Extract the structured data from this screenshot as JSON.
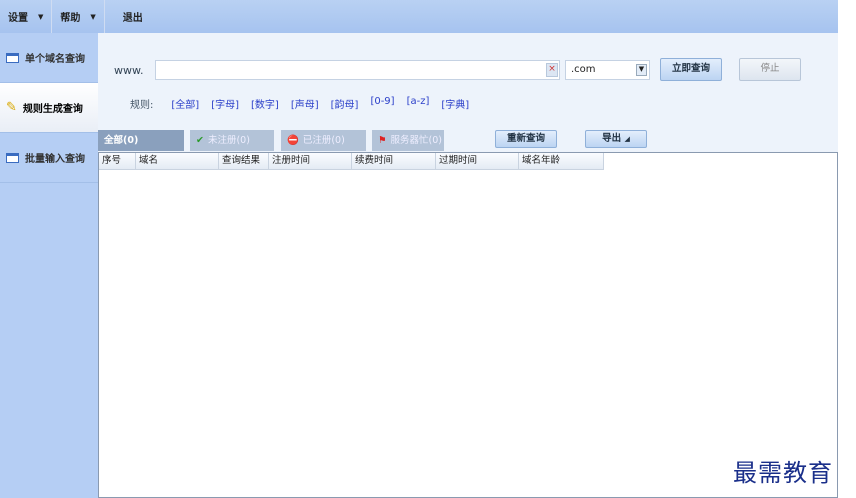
{
  "menu": [
    {
      "label": "设置",
      "dropdown": true
    },
    {
      "label": "帮助",
      "dropdown": true
    },
    {
      "label": "退出",
      "dropdown": false
    }
  ],
  "sidebar": {
    "items": [
      {
        "label": "单个域名查询",
        "icon": "window-icon"
      },
      {
        "label": "规则生成查询",
        "icon": "broom-icon",
        "active": true
      },
      {
        "label": "批量输入查询",
        "icon": "window-icon"
      }
    ]
  },
  "search": {
    "prefix": "www.",
    "value": "",
    "clear_icon": "×",
    "tld": ".com",
    "query_label": "立即查询",
    "stop_label": "停止"
  },
  "rules": {
    "label": "规则:",
    "items": [
      "[全部]",
      "[字母]",
      "[数字]",
      "[声母]",
      "[韵母]",
      "[0-9]",
      "[a-z]",
      "[字典]"
    ]
  },
  "tabs": [
    {
      "label": "全部(0)",
      "active": true
    },
    {
      "label": "未注册(0)",
      "icon": "check-icon"
    },
    {
      "label": "已注册(0)",
      "icon": "stop-icon"
    },
    {
      "label": "服务器忙(0)",
      "icon": "flag-icon"
    }
  ],
  "actions": {
    "requery": "重新查询",
    "export": "导出"
  },
  "table": {
    "columns": [
      "序号",
      "域名",
      "查询结果",
      "注册时间",
      "续费时间",
      "过期时间",
      "域名年龄"
    ],
    "rows": []
  },
  "watermark": "最需教育"
}
